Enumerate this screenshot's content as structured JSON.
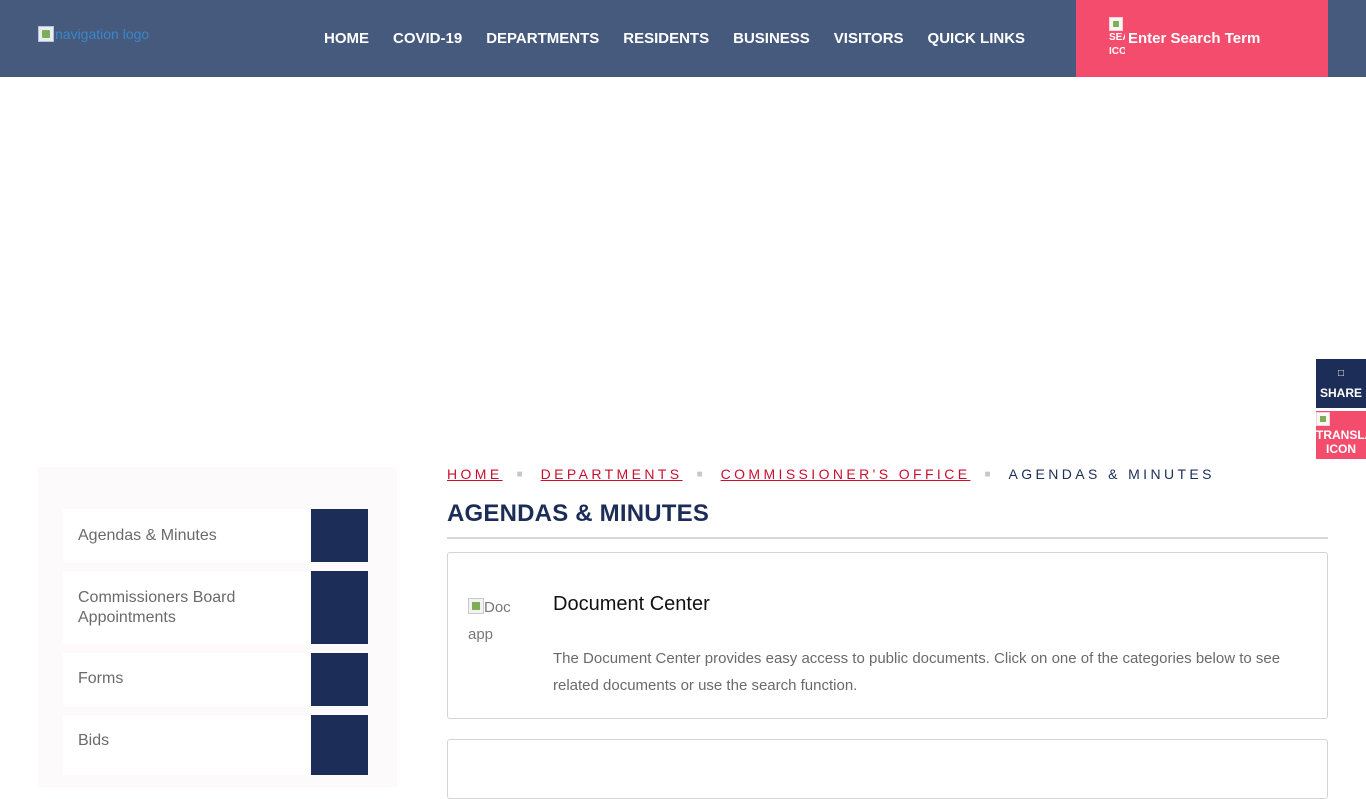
{
  "header": {
    "logo_alt": "navigation logo",
    "nav": [
      "HOME",
      "COVID-19",
      "DEPARTMENTS",
      "RESIDENTS",
      "BUSINESS",
      "VISITORS",
      "QUICK LINKS"
    ],
    "search_icon_alt": "SEARCH ICON",
    "search_placeholder": "Enter Search Term"
  },
  "side_tools": {
    "share_glyph": "□",
    "share_label": "SHARE",
    "translate_alt_line1": "TRANSLATE",
    "translate_alt_line2": "ICON"
  },
  "sidebar": {
    "items": [
      "Agendas & Minutes",
      "Commissioners Board Appointments",
      "Forms",
      "Bids"
    ]
  },
  "breadcrumb": {
    "links": [
      "HOME",
      "DEPARTMENTS",
      "COMMISSIONER'S OFFICE"
    ],
    "current": "AGENDAS & MINUTES"
  },
  "main": {
    "title": "AGENDAS & MINUTES",
    "cards": [
      {
        "img_alt": "Doc app",
        "heading": "Document Center",
        "description": "The Document Center provides easy access to public documents. Click on one of the categories below to see related documents or use the search function."
      }
    ]
  },
  "colors": {
    "header_bg": "#465a7e",
    "accent_pink": "#f44c6c",
    "navy": "#1c2d58",
    "breadcrumb_link": "#c8102e"
  }
}
